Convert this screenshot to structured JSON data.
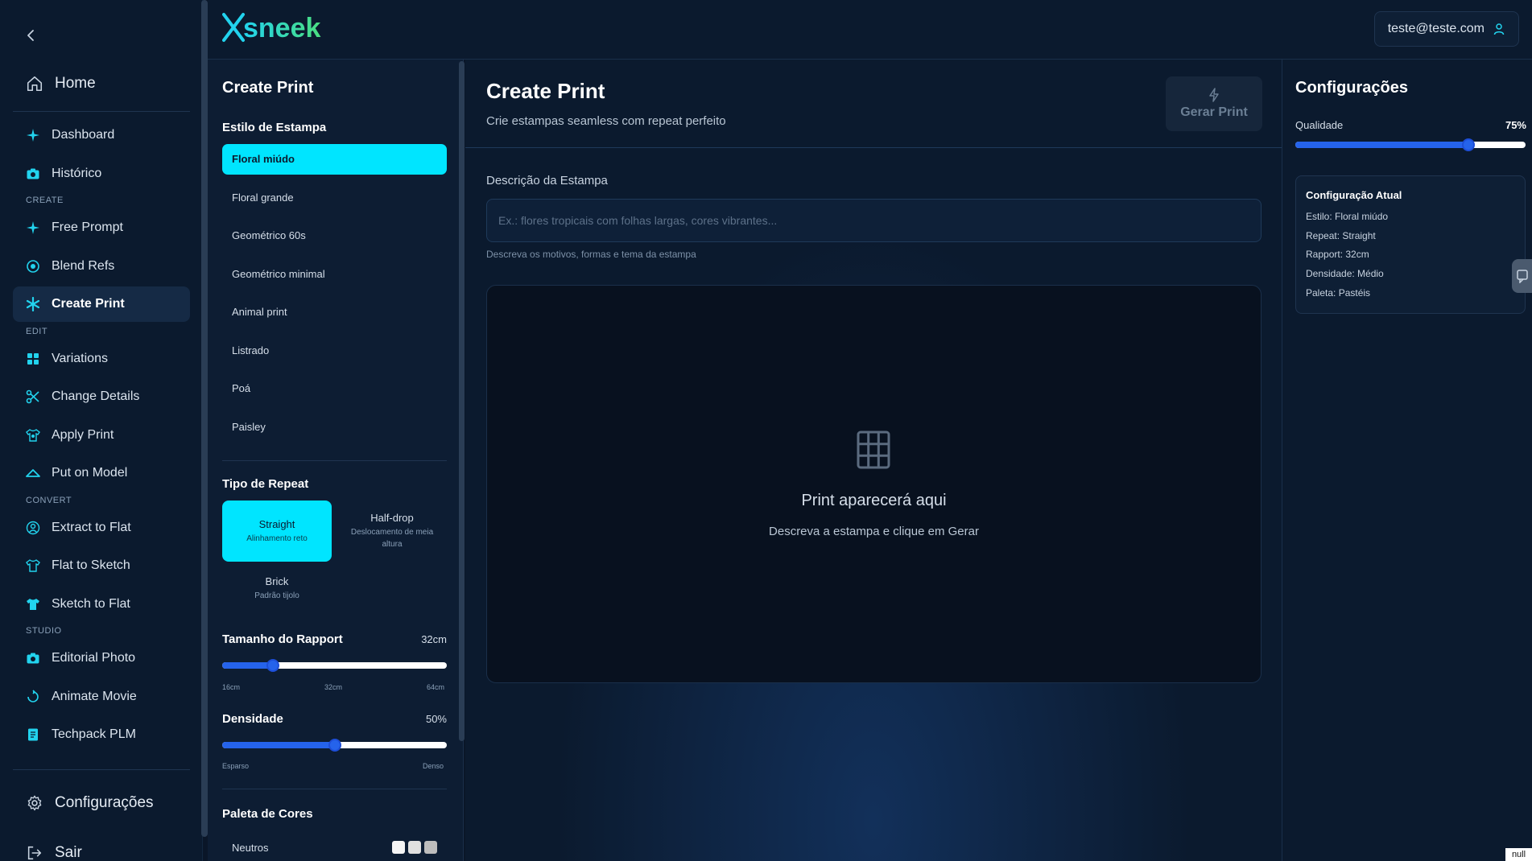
{
  "brand": {
    "logo_text": "sneek",
    "logo_mark": "X"
  },
  "user": {
    "email": "teste@teste.com"
  },
  "sidebar": {
    "home": "Home",
    "items": [
      {
        "type": "item",
        "label": "Dashboard",
        "icon": "sparkle-icon"
      },
      {
        "type": "item",
        "label": "Histórico",
        "icon": "camera-icon"
      },
      {
        "type": "section",
        "label": "CREATE"
      },
      {
        "type": "item",
        "label": "Free Prompt",
        "icon": "sparkle-icon"
      },
      {
        "type": "item",
        "label": "Blend Refs",
        "icon": "blend-icon"
      },
      {
        "type": "item",
        "label": "Create Print",
        "icon": "snowflake-icon",
        "active": true
      },
      {
        "type": "section",
        "label": "EDIT"
      },
      {
        "type": "item",
        "label": "Variations",
        "icon": "grid-icon"
      },
      {
        "type": "item",
        "label": "Change Details",
        "icon": "scissors-icon"
      },
      {
        "type": "item",
        "label": "Apply Print",
        "icon": "shirt-print-icon"
      },
      {
        "type": "item",
        "label": "Put on Model",
        "icon": "hanger-icon"
      },
      {
        "type": "section",
        "label": "CONVERT"
      },
      {
        "type": "item",
        "label": "Extract to Flat",
        "icon": "person-icon"
      },
      {
        "type": "item",
        "label": "Flat to Sketch",
        "icon": "tshirt-outline-icon"
      },
      {
        "type": "item",
        "label": "Sketch to Flat",
        "icon": "tshirt-icon"
      },
      {
        "type": "section",
        "label": "STUDIO"
      },
      {
        "type": "item",
        "label": "Editorial Photo",
        "icon": "camera-icon"
      },
      {
        "type": "item",
        "label": "Animate Movie",
        "icon": "film-icon"
      },
      {
        "type": "item",
        "label": "Techpack PLM",
        "icon": "document-icon"
      }
    ],
    "settings": "Configurações",
    "logout": "Sair"
  },
  "style_panel": {
    "title": "Create Print",
    "style_label": "Estilo de Estampa",
    "styles": [
      "Floral miúdo",
      "Floral grande",
      "Geométrico 60s",
      "Geométrico minimal",
      "Animal print",
      "Listrado",
      "Poá",
      "Paisley"
    ],
    "selected_style": "Floral miúdo",
    "repeat_label": "Tipo de Repeat",
    "repeats": [
      {
        "name": "Straight",
        "desc": "Alinhamento reto",
        "active": true
      },
      {
        "name": "Half-drop",
        "desc": "Deslocamento de meia altura",
        "active": false
      },
      {
        "name": "Brick",
        "desc": "Padrão tijolo",
        "active": false
      }
    ],
    "rapport": {
      "label": "Tamanho do Rapport",
      "value_text": "32cm",
      "value": 32,
      "min": 16,
      "max": 64,
      "ticks": [
        "16cm",
        "32cm",
        "64cm"
      ]
    },
    "density": {
      "label": "Densidade",
      "value_text": "50%",
      "value": 50,
      "min": 0,
      "max": 100,
      "ticks": [
        "Esparso",
        "Denso"
      ]
    },
    "palette_label": "Paleta de Cores",
    "palettes": [
      {
        "name": "Neutros",
        "colors": [
          "#f5f5f5",
          "#e0e0e0",
          "#bdbdbd"
        ]
      }
    ]
  },
  "main": {
    "title": "Create Print",
    "subtitle": "Crie estampas seamless com repeat perfeito",
    "generate_label": "Gerar Print",
    "description_label": "Descrição da Estampa",
    "description_placeholder": "Ex.: flores tropicais com folhas largas, cores vibrantes...",
    "description_value": "",
    "description_hint": "Descreva os motivos, formas e tema da estampa",
    "preview_title": "Print aparecerá aqui",
    "preview_subtitle": "Descreva a estampa e clique em Gerar"
  },
  "config": {
    "title": "Configurações",
    "quality_label": "Qualidade",
    "quality_text": "75%",
    "quality_value": 75,
    "current_title": "Configuração Atual",
    "lines": [
      "Estilo: Floral miúdo",
      "Repeat: Straight",
      "Rapport: 32cm",
      "Densidade: Médio",
      "Paleta: Pastéis"
    ]
  },
  "debug_tag": "null",
  "colors": {
    "accent": "#00e5ff",
    "slider": "#2563eb",
    "background": "#0a1628"
  }
}
